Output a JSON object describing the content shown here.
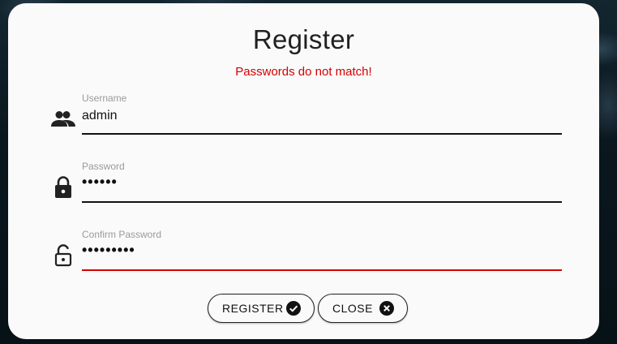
{
  "dialog": {
    "title": "Register",
    "error_message": "Passwords do not match!"
  },
  "fields": [
    {
      "label": "Username",
      "value": "admin",
      "icon": "people-icon"
    },
    {
      "label": "Password",
      "value": "••••••",
      "icon": "lock-icon"
    },
    {
      "label": "Confirm Password",
      "value": "•••••••••",
      "icon": "lock-open-icon"
    }
  ],
  "buttons": {
    "register_label": "REGISTER",
    "register_icon": "check-circle-icon",
    "close_label": "CLOSE",
    "close_icon": "close-circle-icon"
  },
  "colors": {
    "error": "#d50000",
    "surface": "#fafafa",
    "text": "#212121"
  }
}
